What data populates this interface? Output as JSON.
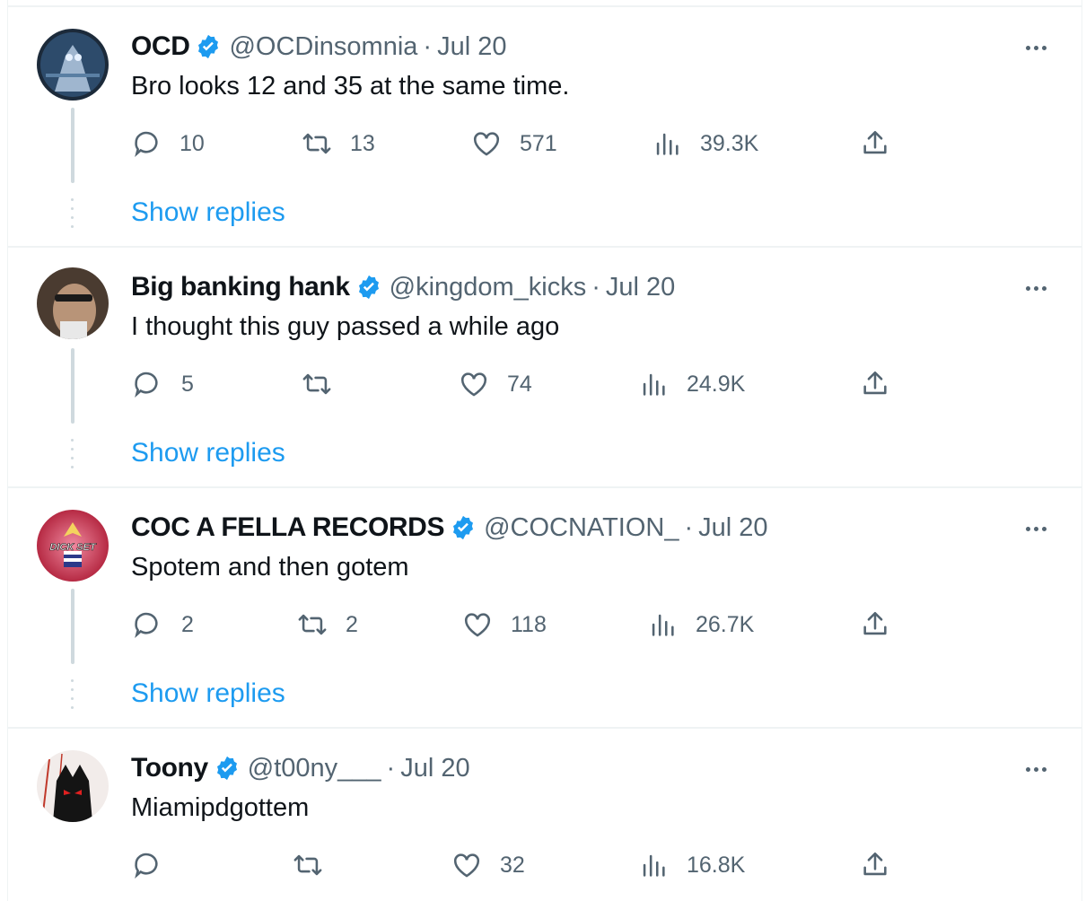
{
  "colors": {
    "accent": "#1d9bf0",
    "text_primary": "#0f1419",
    "text_secondary": "#536471",
    "divider": "#eff3f4",
    "thread_line": "#cfd9de"
  },
  "icons": {
    "verified": "verified-badge-icon",
    "reply": "reply-icon",
    "retweet": "retweet-icon",
    "like": "heart-icon",
    "views": "views-icon",
    "share": "share-icon",
    "more": "more-icon"
  },
  "tweets": [
    {
      "name": "OCD",
      "handle": "@OCDinsomnia",
      "separator": "·",
      "date": "Jul 20",
      "text": "Bro looks 12 and 35 at the same time.",
      "replies": "10",
      "retweets": "13",
      "likes": "571",
      "views": "39.3K",
      "show_replies": "Show replies"
    },
    {
      "name": "Big banking hank",
      "handle": "@kingdom_kicks",
      "separator": "·",
      "date": "Jul 20",
      "text": "I thought this guy passed a while ago",
      "replies": "5",
      "retweets": "",
      "likes": "74",
      "views": "24.9K",
      "show_replies": "Show replies"
    },
    {
      "name": "COC A FELLA RECORDS",
      "handle": "@COCNATION_",
      "separator": "·",
      "date": "Jul 20",
      "text": "Spotem and then gotem",
      "replies": "2",
      "retweets": "2",
      "likes": "118",
      "views": "26.7K",
      "show_replies": "Show replies",
      "avatar_text": "DICK SET"
    },
    {
      "name": "Toony",
      "handle": "@t00ny___",
      "separator": "·",
      "date": "Jul 20",
      "text": "Miamipdgottem",
      "replies": "",
      "retweets": "",
      "likes": "32",
      "views": "16.8K"
    }
  ]
}
